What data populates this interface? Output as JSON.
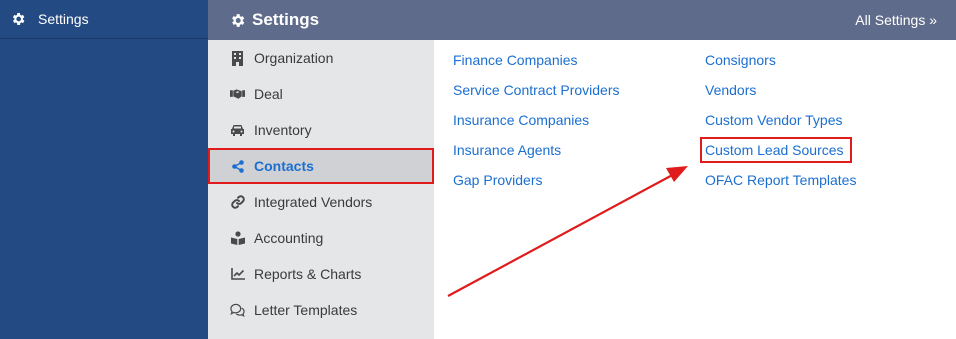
{
  "sidebar": {
    "title": "Settings",
    "icon": "gear-icon"
  },
  "topbar": {
    "title": "Settings",
    "all_settings": "All Settings »"
  },
  "menu": [
    {
      "label": "Organization",
      "icon": "building-icon"
    },
    {
      "label": "Deal",
      "icon": "handshake-icon"
    },
    {
      "label": "Inventory",
      "icon": "car-icon"
    },
    {
      "label": "Contacts",
      "icon": "share-nodes-icon",
      "active": true
    },
    {
      "label": "Integrated Vendors",
      "icon": "link-icon"
    },
    {
      "label": "Accounting",
      "icon": "book-reader-icon"
    },
    {
      "label": "Reports & Charts",
      "icon": "line-chart-icon"
    },
    {
      "label": "Letter Templates",
      "icon": "comments-icon"
    }
  ],
  "links": {
    "col1": [
      "Finance Companies",
      "Service Contract Providers",
      "Insurance Companies",
      "Insurance Agents",
      "Gap Providers"
    ],
    "col2": [
      "Consignors",
      "Vendors",
      "Custom Vendor Types",
      "Custom Lead Sources",
      "OFAC Report Templates"
    ]
  },
  "colors": {
    "sidebar": "#234a82",
    "topbar": "#5f6b8a",
    "link": "#1b6fd1",
    "highlight": "#e01b1b"
  }
}
